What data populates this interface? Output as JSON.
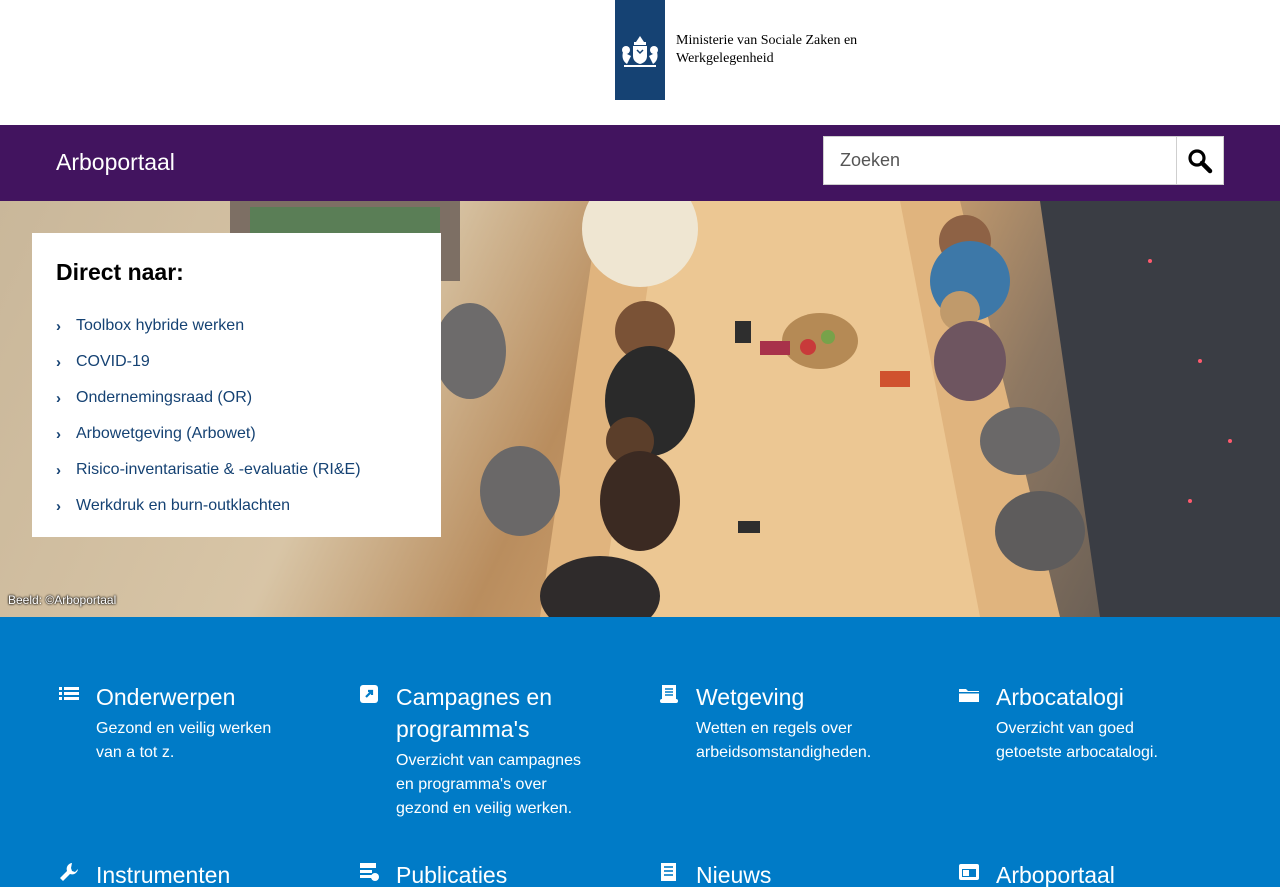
{
  "header": {
    "ministry_line1": "Ministerie van Sociale Zaken en",
    "ministry_line2": "Werkgelegenheid",
    "logo_bar_color": "#154273"
  },
  "nav": {
    "site_title": "Arboportaal",
    "search_placeholder": "Zoeken",
    "bar_color": "#42145f"
  },
  "hero": {
    "direct_title": "Direct naar:",
    "links": [
      {
        "label": "Toolbox hybride werken"
      },
      {
        "label": "COVID-19"
      },
      {
        "label": "Ondernemingsraad (OR)"
      },
      {
        "label": "Arbowetgeving (Arbowet)"
      },
      {
        "label": "Risico-inventarisatie & -evaluatie (RI&E)"
      },
      {
        "label": "Werkdruk en burn-outklachten"
      }
    ],
    "credit": "Beeld: ©Arboportaal",
    "link_color": "#154273"
  },
  "tiles": {
    "background": "#007bc7",
    "items": [
      {
        "title": "Onderwerpen",
        "desc": "Gezond en veilig werken van a tot z.",
        "icon": "list-icon"
      },
      {
        "title": "Campagnes en programma's",
        "desc": "Overzicht van campagnes en programma's over gezond en veilig werken.",
        "icon": "external-link-icon"
      },
      {
        "title": "Wetgeving",
        "desc": "Wetten en regels over arbeidsomstandigheden.",
        "icon": "scroll-icon"
      },
      {
        "title": "Arbocatalogi",
        "desc": "Overzicht van goed getoetste arbocatalogi.",
        "icon": "folder-icon"
      },
      {
        "title": "Instrumenten",
        "desc": "",
        "icon": "wrench-icon"
      },
      {
        "title": "Publicaties",
        "desc": "",
        "icon": "publication-icon"
      },
      {
        "title": "Nieuws",
        "desc": "",
        "icon": "newspaper-icon"
      },
      {
        "title": "Arboportaal",
        "desc": "",
        "icon": "browser-window-icon"
      }
    ]
  }
}
